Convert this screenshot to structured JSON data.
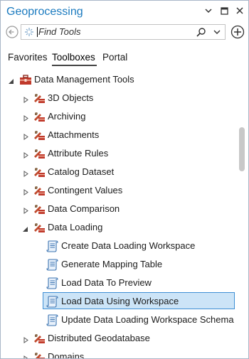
{
  "window": {
    "title": "Geoprocessing"
  },
  "search": {
    "placeholder": "Find Tools",
    "value": ""
  },
  "tabs": [
    {
      "label": "Favorites",
      "active": false
    },
    {
      "label": "Toolboxes",
      "active": true
    },
    {
      "label": "Portal",
      "active": false
    }
  ],
  "tree": {
    "root": {
      "label": "Data Management Tools",
      "expanded": true
    },
    "toolsets": [
      {
        "label": "3D Objects",
        "expanded": false
      },
      {
        "label": "Archiving",
        "expanded": false
      },
      {
        "label": "Attachments",
        "expanded": false
      },
      {
        "label": "Attribute Rules",
        "expanded": false
      },
      {
        "label": "Catalog Dataset",
        "expanded": false
      },
      {
        "label": "Contingent Values",
        "expanded": false
      },
      {
        "label": "Data Comparison",
        "expanded": false
      },
      {
        "label": "Data Loading",
        "expanded": true
      },
      {
        "label": "Distributed Geodatabase",
        "expanded": false
      },
      {
        "label": "Domains",
        "expanded": false
      }
    ],
    "data_loading_tools": [
      {
        "label": "Create Data Loading Workspace",
        "selected": false
      },
      {
        "label": "Generate Mapping Table",
        "selected": false
      },
      {
        "label": "Load Data To Preview",
        "selected": false
      },
      {
        "label": "Load Data Using Workspace",
        "selected": true
      },
      {
        "label": "Update Data Loading Workspace Schema",
        "selected": false
      }
    ]
  },
  "icons": {
    "toolbox": "toolbox-icon",
    "toolset": "toolset-icon",
    "tool": "script-tool-icon"
  },
  "colors": {
    "title": "#1a7abf",
    "selection_bg": "#cce4f7",
    "selection_border": "#3e8fd4",
    "toolbox_red": "#c0392b"
  }
}
